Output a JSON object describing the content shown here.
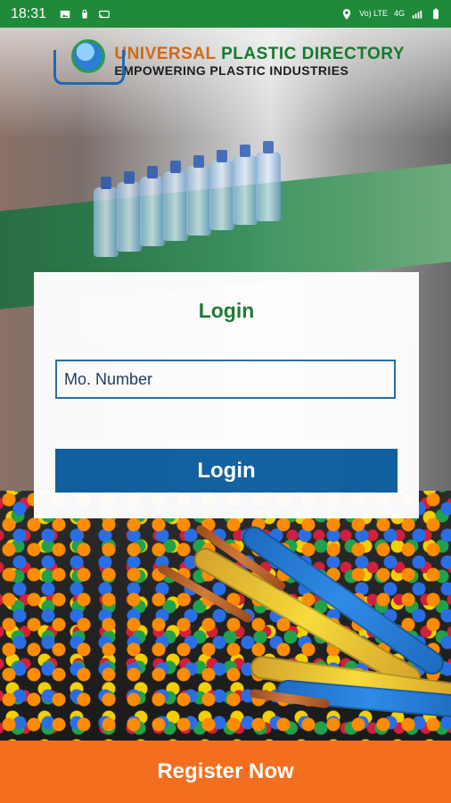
{
  "status_bar": {
    "time": "18:31",
    "network": "Vo) LTE",
    "network_type": "4G",
    "icons_left": [
      "photo-icon",
      "bag-icon",
      "cast-icon"
    ],
    "icons_right": [
      "location-icon",
      "signal-icon",
      "battery-icon"
    ]
  },
  "header": {
    "brand_line1_a": "UNIVERSAL",
    "brand_line1_b": "PLASTIC DIRECTORY",
    "brand_line2": "EMPOWERING PLASTIC INDUSTRIES"
  },
  "login_card": {
    "title": "Login",
    "mobile_placeholder": "Mo. Number",
    "login_button": "Login"
  },
  "footer": {
    "register_button": "Register Now"
  },
  "colors": {
    "status_bar": "#1f8a3a",
    "title_green": "#1a7b2f",
    "login_blue": "#0e5fa0",
    "register_orange": "#f36f1f"
  }
}
